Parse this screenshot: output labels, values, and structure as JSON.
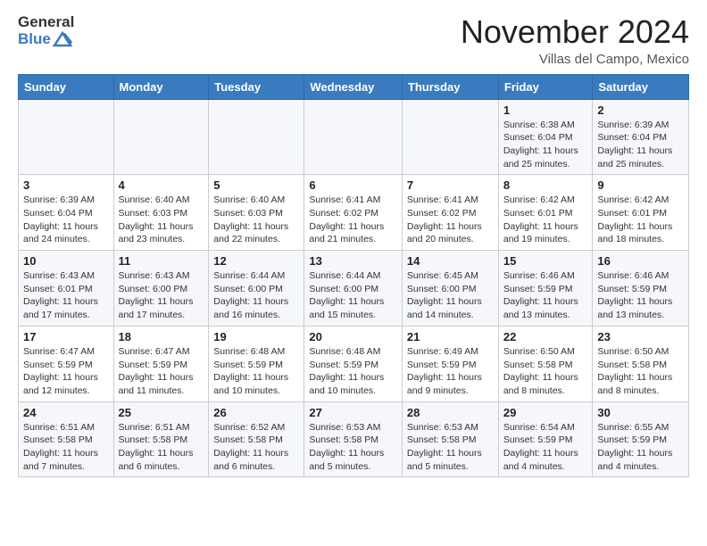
{
  "header": {
    "logo_general": "General",
    "logo_blue": "Blue",
    "title": "November 2024",
    "subtitle": "Villas del Campo, Mexico"
  },
  "days_of_week": [
    "Sunday",
    "Monday",
    "Tuesday",
    "Wednesday",
    "Thursday",
    "Friday",
    "Saturday"
  ],
  "weeks": [
    [
      {
        "day": "",
        "info": ""
      },
      {
        "day": "",
        "info": ""
      },
      {
        "day": "",
        "info": ""
      },
      {
        "day": "",
        "info": ""
      },
      {
        "day": "",
        "info": ""
      },
      {
        "day": "1",
        "info": "Sunrise: 6:38 AM\nSunset: 6:04 PM\nDaylight: 11 hours and 25 minutes."
      },
      {
        "day": "2",
        "info": "Sunrise: 6:39 AM\nSunset: 6:04 PM\nDaylight: 11 hours and 25 minutes."
      }
    ],
    [
      {
        "day": "3",
        "info": "Sunrise: 6:39 AM\nSunset: 6:04 PM\nDaylight: 11 hours and 24 minutes."
      },
      {
        "day": "4",
        "info": "Sunrise: 6:40 AM\nSunset: 6:03 PM\nDaylight: 11 hours and 23 minutes."
      },
      {
        "day": "5",
        "info": "Sunrise: 6:40 AM\nSunset: 6:03 PM\nDaylight: 11 hours and 22 minutes."
      },
      {
        "day": "6",
        "info": "Sunrise: 6:41 AM\nSunset: 6:02 PM\nDaylight: 11 hours and 21 minutes."
      },
      {
        "day": "7",
        "info": "Sunrise: 6:41 AM\nSunset: 6:02 PM\nDaylight: 11 hours and 20 minutes."
      },
      {
        "day": "8",
        "info": "Sunrise: 6:42 AM\nSunset: 6:01 PM\nDaylight: 11 hours and 19 minutes."
      },
      {
        "day": "9",
        "info": "Sunrise: 6:42 AM\nSunset: 6:01 PM\nDaylight: 11 hours and 18 minutes."
      }
    ],
    [
      {
        "day": "10",
        "info": "Sunrise: 6:43 AM\nSunset: 6:01 PM\nDaylight: 11 hours and 17 minutes."
      },
      {
        "day": "11",
        "info": "Sunrise: 6:43 AM\nSunset: 6:00 PM\nDaylight: 11 hours and 17 minutes."
      },
      {
        "day": "12",
        "info": "Sunrise: 6:44 AM\nSunset: 6:00 PM\nDaylight: 11 hours and 16 minutes."
      },
      {
        "day": "13",
        "info": "Sunrise: 6:44 AM\nSunset: 6:00 PM\nDaylight: 11 hours and 15 minutes."
      },
      {
        "day": "14",
        "info": "Sunrise: 6:45 AM\nSunset: 6:00 PM\nDaylight: 11 hours and 14 minutes."
      },
      {
        "day": "15",
        "info": "Sunrise: 6:46 AM\nSunset: 5:59 PM\nDaylight: 11 hours and 13 minutes."
      },
      {
        "day": "16",
        "info": "Sunrise: 6:46 AM\nSunset: 5:59 PM\nDaylight: 11 hours and 13 minutes."
      }
    ],
    [
      {
        "day": "17",
        "info": "Sunrise: 6:47 AM\nSunset: 5:59 PM\nDaylight: 11 hours and 12 minutes."
      },
      {
        "day": "18",
        "info": "Sunrise: 6:47 AM\nSunset: 5:59 PM\nDaylight: 11 hours and 11 minutes."
      },
      {
        "day": "19",
        "info": "Sunrise: 6:48 AM\nSunset: 5:59 PM\nDaylight: 11 hours and 10 minutes."
      },
      {
        "day": "20",
        "info": "Sunrise: 6:48 AM\nSunset: 5:59 PM\nDaylight: 11 hours and 10 minutes."
      },
      {
        "day": "21",
        "info": "Sunrise: 6:49 AM\nSunset: 5:59 PM\nDaylight: 11 hours and 9 minutes."
      },
      {
        "day": "22",
        "info": "Sunrise: 6:50 AM\nSunset: 5:58 PM\nDaylight: 11 hours and 8 minutes."
      },
      {
        "day": "23",
        "info": "Sunrise: 6:50 AM\nSunset: 5:58 PM\nDaylight: 11 hours and 8 minutes."
      }
    ],
    [
      {
        "day": "24",
        "info": "Sunrise: 6:51 AM\nSunset: 5:58 PM\nDaylight: 11 hours and 7 minutes."
      },
      {
        "day": "25",
        "info": "Sunrise: 6:51 AM\nSunset: 5:58 PM\nDaylight: 11 hours and 6 minutes."
      },
      {
        "day": "26",
        "info": "Sunrise: 6:52 AM\nSunset: 5:58 PM\nDaylight: 11 hours and 6 minutes."
      },
      {
        "day": "27",
        "info": "Sunrise: 6:53 AM\nSunset: 5:58 PM\nDaylight: 11 hours and 5 minutes."
      },
      {
        "day": "28",
        "info": "Sunrise: 6:53 AM\nSunset: 5:58 PM\nDaylight: 11 hours and 5 minutes."
      },
      {
        "day": "29",
        "info": "Sunrise: 6:54 AM\nSunset: 5:59 PM\nDaylight: 11 hours and 4 minutes."
      },
      {
        "day": "30",
        "info": "Sunrise: 6:55 AM\nSunset: 5:59 PM\nDaylight: 11 hours and 4 minutes."
      }
    ]
  ]
}
